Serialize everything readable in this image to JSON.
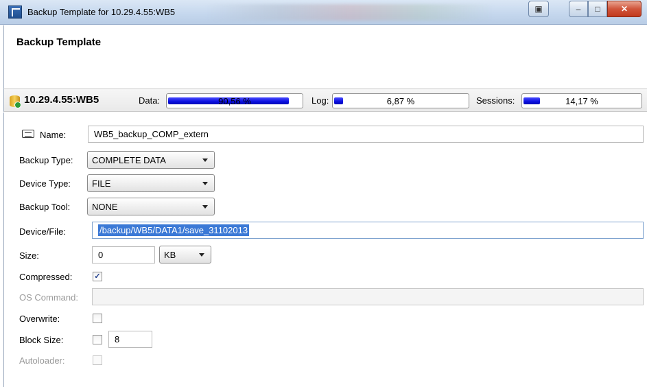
{
  "window": {
    "title": "Backup Template for 10.29.4.55:WB5"
  },
  "header": {
    "heading": "Backup Template"
  },
  "status": {
    "host": "10.29.4.55:WB5",
    "data_label": "Data:",
    "data_percent": "90,56 %",
    "data_value": 90.56,
    "log_label": "Log:",
    "log_percent": "6,87 %",
    "log_value": 6.87,
    "sessions_label": "Sessions:",
    "sessions_percent": "14,17 %",
    "sessions_value": 14.17,
    "fill_color": "#0b0fe0"
  },
  "form": {
    "name_label": "Name:",
    "name_value": "WB5_backup_COMP_extern",
    "backup_type_label": "Backup Type:",
    "backup_type_value": "COMPLETE DATA",
    "device_type_label": "Device Type:",
    "device_type_value": "FILE",
    "backup_tool_label": "Backup Tool:",
    "backup_tool_value": "NONE",
    "device_file_label": "Device/File:",
    "device_file_value": "/backup/WB5/DATA1/save_31102013",
    "size_label": "Size:",
    "size_value": "0",
    "size_unit": "KB",
    "compressed_label": "Compressed:",
    "compressed_checked": true,
    "os_command_label": "OS Command:",
    "os_command_value": "",
    "overwrite_label": "Overwrite:",
    "overwrite_checked": false,
    "block_size_label": "Block Size:",
    "block_size_checked": false,
    "block_size_value": "8",
    "autoloader_label": "Autoloader:",
    "autoloader_checked": false
  },
  "icons": {
    "app": "app-window-icon",
    "database": "database-status-icon",
    "name": "name-card-icon"
  }
}
